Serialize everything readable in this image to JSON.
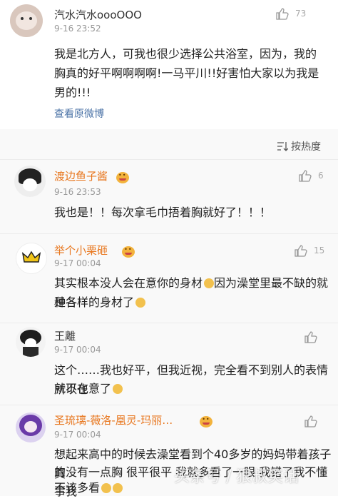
{
  "post": {
    "user": "汽水汽水oooOOO",
    "time": "9-16 23:52",
    "likes": "73",
    "lines": [
      "我是北方人，可我也很少选择公共浴室，因为，我的",
      "胸真的好平啊啊啊啊!一马平川!!好害怕大家以为我是",
      "男的!!!"
    ],
    "view_original": "查看原微博"
  },
  "sort_label": "按热度",
  "comments": [
    {
      "user": "渡边鱼子酱",
      "time": "9-16 23:53",
      "likes": "6",
      "lines": [
        "我也是！！每次拿毛巾捂着胸就好了！！！"
      ]
    },
    {
      "user": "举个小栗砸",
      "time": "9-17 00:04",
      "likes": "15",
      "lines": [
        "其实根本没人会在意你的身材",
        "因为澡堂里最不缺的就是各",
        "种各样的身材了"
      ]
    },
    {
      "user": "王離",
      "time": "9-17 00:04",
      "likes": "",
      "lines": [
        "这个……我也好平，但我近视，完全看不到别人的表情所以也",
        "就不在意了"
      ]
    },
    {
      "user": "圣琉璃-薇洛-凰灵-玛丽…",
      "time": "9-17 00:04",
      "likes": "",
      "lines": [
        "想起来高中的时候去澡堂看到个40多岁的妈妈带着孩子 真",
        "的没有一点胸 很平很平 我就多看了一眼 我错了我不懂事我",
        "不该多看"
      ]
    }
  ],
  "watermark": "头条号 / 狠叔笑话"
}
